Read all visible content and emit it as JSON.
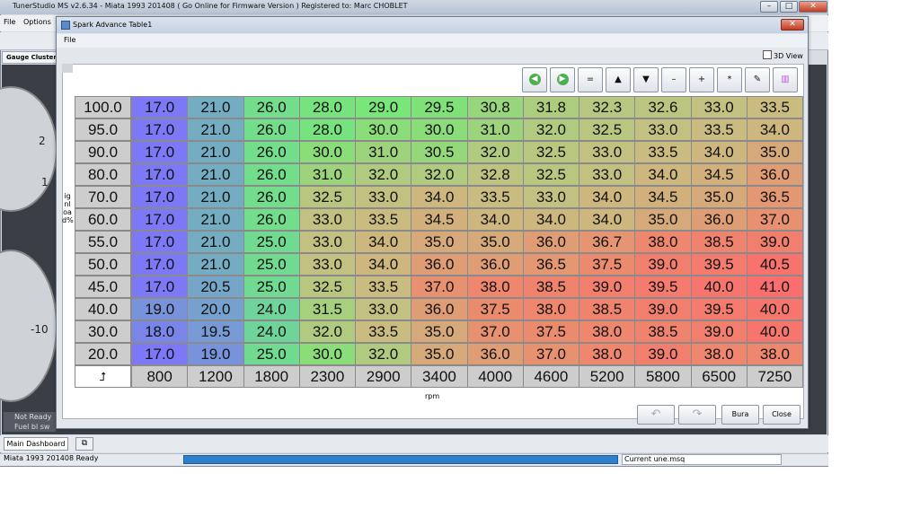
{
  "app": {
    "title": "TunerStudio MS v2.6.34 - Miata 1993 201408 ( Go Online for Firmware Version ) Registered to: Marc CHOBLET",
    "minimize": "–",
    "maximize": "□",
    "close": "✕",
    "menu": [
      "File",
      "Options"
    ],
    "gauge_cluster_tab": "Gauge Cluster",
    "gauge_numbers": [
      "2",
      "1",
      "-10"
    ],
    "left_status": [
      "Not Ready",
      "Fuel  bl sw"
    ],
    "bottom_tab": "Main Dashboard",
    "status_left": "Miata 1993 201408 Ready",
    "status_progress": 1.0,
    "status_file": "Current  une.msq"
  },
  "dialog": {
    "title": "Spark Advance Table1",
    "close": "✕",
    "menu_file": "File",
    "view3d_label": "3D View",
    "y_axis_label": "ignload%",
    "x_axis_label": "rpm",
    "toolbar_icons": [
      "go-back-icon",
      "go-forward-icon",
      "equals-icon",
      "increase-icon",
      "decrease-icon",
      "minus-icon",
      "plus-icon",
      "multiply-icon",
      "pencil-icon",
      "color-palette-icon"
    ],
    "toolbar_glyphs": [
      "◀",
      "▶",
      "=",
      "▲",
      "▼",
      "–",
      "+",
      "*",
      "✎",
      "▥"
    ],
    "corner_symbol": "⮥",
    "undo": "↶",
    "redo": "↷",
    "burn_label": "Bura",
    "close_label": "Close"
  },
  "table": {
    "rpm": [
      "800",
      "1200",
      "1800",
      "2300",
      "2900",
      "3400",
      "4000",
      "4600",
      "5200",
      "5800",
      "6500",
      "7250"
    ],
    "load": [
      "100.0",
      "95.0",
      "90.0",
      "80.0",
      "70.0",
      "60.0",
      "55.0",
      "50.0",
      "45.0",
      "40.0",
      "30.0",
      "20.0"
    ],
    "values": [
      [
        "17.0",
        "21.0",
        "26.0",
        "28.0",
        "29.0",
        "29.5",
        "30.8",
        "31.8",
        "32.3",
        "32.6",
        "33.0",
        "33.5"
      ],
      [
        "17.0",
        "21.0",
        "26.0",
        "28.0",
        "30.0",
        "30.0",
        "31.0",
        "32.0",
        "32.5",
        "33.0",
        "33.5",
        "34.0"
      ],
      [
        "17.0",
        "21.0",
        "26.0",
        "30.0",
        "31.0",
        "30.5",
        "32.0",
        "32.5",
        "33.0",
        "33.5",
        "34.0",
        "35.0"
      ],
      [
        "17.0",
        "21.0",
        "26.0",
        "31.0",
        "32.0",
        "32.0",
        "32.8",
        "32.5",
        "33.0",
        "34.0",
        "34.5",
        "36.0"
      ],
      [
        "17.0",
        "21.0",
        "26.0",
        "32.5",
        "33.0",
        "34.0",
        "33.5",
        "33.0",
        "34.0",
        "34.5",
        "35.0",
        "36.5"
      ],
      [
        "17.0",
        "21.0",
        "26.0",
        "33.0",
        "33.5",
        "34.5",
        "34.0",
        "34.0",
        "34.0",
        "35.0",
        "36.0",
        "37.0"
      ],
      [
        "17.0",
        "21.0",
        "25.0",
        "33.0",
        "34.0",
        "35.0",
        "35.0",
        "36.0",
        "36.7",
        "38.0",
        "38.5",
        "39.0"
      ],
      [
        "17.0",
        "21.0",
        "25.0",
        "33.0",
        "34.0",
        "36.0",
        "36.0",
        "36.5",
        "37.5",
        "39.0",
        "39.5",
        "40.5"
      ],
      [
        "17.0",
        "20.5",
        "25.0",
        "32.5",
        "33.5",
        "37.0",
        "38.0",
        "38.5",
        "39.0",
        "39.5",
        "40.0",
        "41.0"
      ],
      [
        "19.0",
        "20.0",
        "24.0",
        "31.5",
        "33.0",
        "36.0",
        "37.5",
        "38.0",
        "38.5",
        "39.0",
        "39.5",
        "40.0"
      ],
      [
        "18.0",
        "19.5",
        "24.0",
        "32.0",
        "33.5",
        "35.0",
        "37.0",
        "37.5",
        "38.0",
        "38.5",
        "39.0",
        "40.0"
      ],
      [
        "17.0",
        "19.0",
        "25.0",
        "30.0",
        "32.0",
        "35.0",
        "36.0",
        "37.0",
        "38.0",
        "39.0",
        "38.0",
        "38.0"
      ]
    ]
  }
}
